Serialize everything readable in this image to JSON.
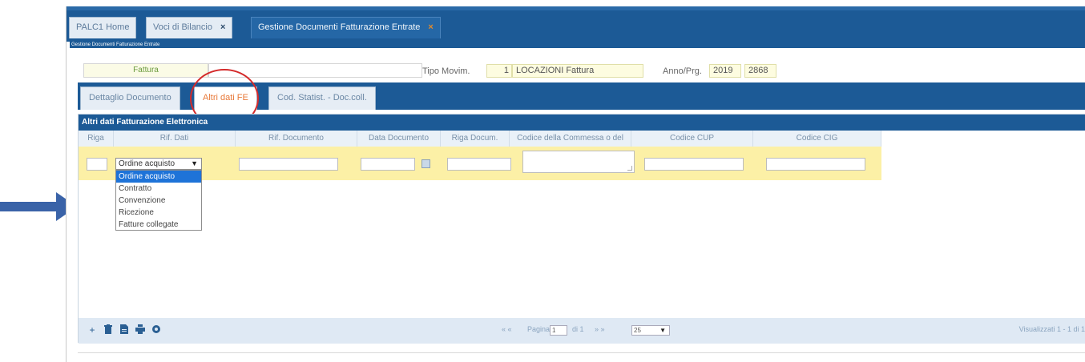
{
  "tabs": [
    {
      "label": "PALC1 Home"
    },
    {
      "label": "Voci di Bilancio",
      "close": "×"
    },
    {
      "label": "Gestione Documenti Fatturazione Entrate",
      "close": "×"
    }
  ],
  "page_subtitle": "Gestione Documenti Fatturazione Entrate",
  "header": {
    "doc_type": "Fattura",
    "tipo_movim_label": "Tipo Movim.",
    "tipo_movim_code": "1",
    "tipo_movim_desc": "LOCAZIONI  Fattura",
    "anno_prg_label": "Anno/Prg.",
    "anno": "2019",
    "prg": "2868"
  },
  "section_tabs": [
    {
      "label": "Dettaglio Documento"
    },
    {
      "label": "Altri dati FE",
      "active": true
    },
    {
      "label": "Cod. Statist. - Doc.coll."
    }
  ],
  "grid": {
    "title": "Altri dati Fatturazione Elettronica",
    "columns": [
      "Riga",
      "Rif. Dati",
      "Rif. Documento",
      "Data Documento",
      "Riga Docum.",
      "Codice della Commessa o del",
      "Codice CUP",
      "Codice CIG"
    ],
    "rif_dati_selected": "Ordine acquisto",
    "rif_dati_options": [
      "Ordine acquisto",
      "Contratto",
      "Convenzione",
      "Ricezione",
      "Fatture collegate"
    ]
  },
  "footer": {
    "icons": [
      "add-icon",
      "delete-icon",
      "export-icon",
      "print-icon",
      "settings-icon"
    ],
    "pager_prev": "«  «",
    "pager_label": "Pagina",
    "page_value": "1",
    "of_label": "di 1",
    "pager_next": "»  »",
    "page_size": "25",
    "records": "Visualizzati 1 - 1 di 1"
  },
  "colors": {
    "brand_blue": "#1c5a96",
    "row_yellow": "#fcf0a6",
    "annotation_red": "#d42a2a",
    "annotation_arrow": "#3a63a8"
  }
}
